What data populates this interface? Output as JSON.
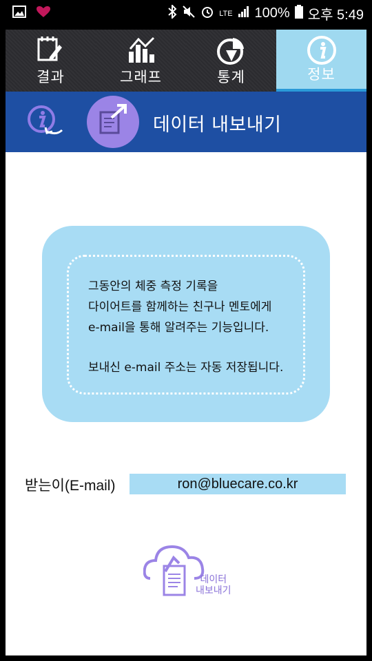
{
  "status_bar": {
    "battery": "100%",
    "time": "오후 5:49",
    "network": "LTE"
  },
  "tabs": [
    {
      "label": "결과",
      "icon": "notepad-pencil-icon",
      "active": false
    },
    {
      "label": "그래프",
      "icon": "bar-chart-icon",
      "active": false
    },
    {
      "label": "통계",
      "icon": "pie-chart-icon",
      "active": false
    },
    {
      "label": "정보",
      "icon": "info-icon",
      "active": true
    }
  ],
  "header": {
    "title": "데이터 내보내기",
    "back_icon": "info-back-icon",
    "export_icon": "document-export-icon"
  },
  "info": {
    "lines": [
      "그동안의 체중 측정 기록을",
      "다이어트를 함께하는 친구나 멘토에게",
      "e-mail을 통해 알려주는 기능입니다."
    ],
    "note": "보내신 e-mail 주소는 자동 저장됩니다."
  },
  "email": {
    "label": "받는이(E-mail)",
    "value": "ron@bluecare.co.kr"
  },
  "export_button": {
    "line1": "데이터",
    "line2": "내보내기"
  },
  "colors": {
    "header_bg": "#1e4fa3",
    "active_tab": "#9fd9f0",
    "box_bg": "#a8dcf4",
    "accent_purple": "#9b84e6"
  }
}
